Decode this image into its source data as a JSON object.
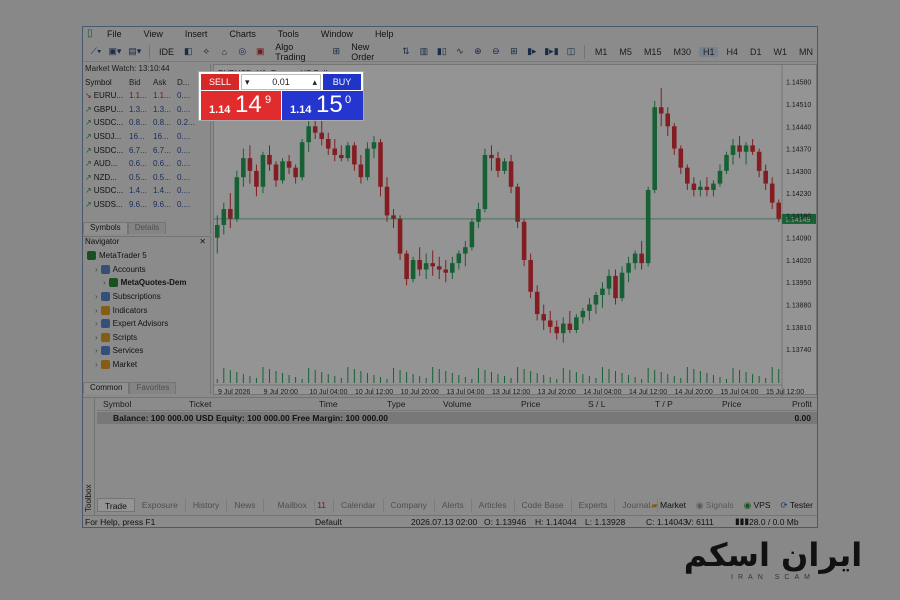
{
  "menu": [
    "File",
    "View",
    "Insert",
    "Charts",
    "Tools",
    "Window",
    "Help"
  ],
  "toolbar": {
    "ide_label": "IDE",
    "algo_trading": "Algo Trading",
    "new_order": "New Order",
    "timeframes": [
      "M1",
      "M5",
      "M15",
      "M30",
      "H1",
      "H4",
      "D1",
      "W1",
      "MN"
    ],
    "active_timeframe": "H1"
  },
  "market_watch": {
    "title": "Market Watch: 13:10:44",
    "headers": [
      "Symbol",
      "Bid",
      "Ask",
      "D..."
    ],
    "rows": [
      {
        "symbol": "EURU...",
        "bid": "1.1...",
        "ask": "1.1...",
        "d": "0....",
        "dir": "down"
      },
      {
        "symbol": "GBPU...",
        "bid": "1.3...",
        "ask": "1.3...",
        "d": "0....",
        "dir": "up"
      },
      {
        "symbol": "USDC...",
        "bid": "0.8...",
        "ask": "0.8...",
        "d": "0.2...",
        "dir": "up"
      },
      {
        "symbol": "USDJ...",
        "bid": "16...",
        "ask": "16...",
        "d": "0....",
        "dir": "up"
      },
      {
        "symbol": "USDC...",
        "bid": "6.7...",
        "ask": "6.7...",
        "d": "0....",
        "dir": "up"
      },
      {
        "symbol": "AUD...",
        "bid": "0.6...",
        "ask": "0.6...",
        "d": "0....",
        "dir": "up"
      },
      {
        "symbol": "NZD...",
        "bid": "0.5...",
        "ask": "0.5...",
        "d": "0....",
        "dir": "up"
      },
      {
        "symbol": "USDC...",
        "bid": "1.4...",
        "ask": "1.4...",
        "d": "0....",
        "dir": "up"
      },
      {
        "symbol": "USDS...",
        "bid": "9.6...",
        "ask": "9.6...",
        "d": "0....",
        "dir": "up"
      }
    ],
    "tabs": [
      "Symbols",
      "Details"
    ]
  },
  "navigator": {
    "title": "Navigator",
    "items": [
      {
        "label": "MetaTrader 5",
        "indent": 0,
        "color": "#2a8a3a"
      },
      {
        "label": "Accounts",
        "indent": 1,
        "color": "#5a8ad0"
      },
      {
        "label": "MetaQuotes-Dem",
        "indent": 2,
        "color": "#2a8a3a"
      },
      {
        "label": "Subscriptions",
        "indent": 1,
        "color": "#5a8ad0"
      },
      {
        "label": "Indicators",
        "indent": 1,
        "color": "#e0a020"
      },
      {
        "label": "Expert Advisors",
        "indent": 1,
        "color": "#5a8ad0"
      },
      {
        "label": "Scripts",
        "indent": 1,
        "color": "#e0a020"
      },
      {
        "label": "Services",
        "indent": 1,
        "color": "#5a8ad0"
      },
      {
        "label": "Market",
        "indent": 1,
        "color": "#e0a020"
      }
    ],
    "tabs": [
      "Common",
      "Favorites"
    ]
  },
  "trade_panel": {
    "sell_label": "SELL",
    "buy_label": "BUY",
    "lot": "0.01",
    "sell_prefix": "1.14",
    "sell_big": "14",
    "sell_sup": "9",
    "buy_prefix": "1.14",
    "buy_big": "15",
    "buy_sup": "0"
  },
  "chart": {
    "symbol_title": "EURUSD, H1: Euro vs US Dollar",
    "price_labels": [
      "1.14580",
      "1.14510",
      "1.14440",
      "1.14370",
      "1.14300",
      "1.14230",
      "1.14160",
      "1.14090",
      "1.14020",
      "1.13950",
      "1.13880",
      "1.13810",
      "1.13740"
    ],
    "time_labels": [
      "9 Jul 2026",
      "9 Jul 20:00",
      "10 Jul 04:00",
      "10 Jul 12:00",
      "10 Jul 20:00",
      "13 Jul 04:00",
      "13 Jul 12:00",
      "13 Jul 20:00",
      "14 Jul 04:00",
      "14 Jul 12:00",
      "14 Jul 20:00",
      "15 Jul 04:00",
      "15 Jul 12:00"
    ],
    "current_price_label": "1.14149",
    "up_color": "#26a65b",
    "down_color": "#e0333a"
  },
  "chart_data": {
    "type": "candlestick",
    "ohlc": [
      [
        1.1409,
        1.1416,
        1.1404,
        1.1413
      ],
      [
        1.1413,
        1.142,
        1.141,
        1.1418
      ],
      [
        1.1418,
        1.1423,
        1.1412,
        1.1415
      ],
      [
        1.1415,
        1.143,
        1.1414,
        1.1428
      ],
      [
        1.1428,
        1.1437,
        1.1425,
        1.1434
      ],
      [
        1.1434,
        1.1438,
        1.1426,
        1.143
      ],
      [
        1.143,
        1.1432,
        1.1422,
        1.1425
      ],
      [
        1.1425,
        1.1436,
        1.1423,
        1.1435
      ],
      [
        1.1435,
        1.1438,
        1.143,
        1.1432
      ],
      [
        1.1432,
        1.1433,
        1.1425,
        1.1427
      ],
      [
        1.1427,
        1.1434,
        1.1426,
        1.1433
      ],
      [
        1.1433,
        1.1435,
        1.1429,
        1.1431
      ],
      [
        1.1431,
        1.1432,
        1.1426,
        1.1428
      ],
      [
        1.1428,
        1.144,
        1.1427,
        1.1439
      ],
      [
        1.1439,
        1.1447,
        1.1436,
        1.1444
      ],
      [
        1.1444,
        1.145,
        1.144,
        1.1442
      ],
      [
        1.1442,
        1.1446,
        1.1438,
        1.144
      ],
      [
        1.144,
        1.1442,
        1.1435,
        1.1437
      ],
      [
        1.1437,
        1.144,
        1.1433,
        1.1435
      ],
      [
        1.1435,
        1.1438,
        1.1433,
        1.1434
      ],
      [
        1.1434,
        1.1439,
        1.1433,
        1.1438
      ],
      [
        1.1438,
        1.1439,
        1.143,
        1.1432
      ],
      [
        1.1432,
        1.1435,
        1.1426,
        1.1428
      ],
      [
        1.1428,
        1.1439,
        1.1427,
        1.1437
      ],
      [
        1.1437,
        1.1441,
        1.1434,
        1.1439
      ],
      [
        1.1439,
        1.144,
        1.1422,
        1.1425
      ],
      [
        1.1425,
        1.1428,
        1.1414,
        1.1416
      ],
      [
        1.1416,
        1.1418,
        1.1412,
        1.1415
      ],
      [
        1.1415,
        1.1416,
        1.1402,
        1.1404
      ],
      [
        1.1404,
        1.1405,
        1.1394,
        1.1396
      ],
      [
        1.1396,
        1.1403,
        1.1395,
        1.1402
      ],
      [
        1.1402,
        1.1406,
        1.1397,
        1.1399
      ],
      [
        1.1399,
        1.1404,
        1.1396,
        1.1401
      ],
      [
        1.1401,
        1.1405,
        1.1397,
        1.14
      ],
      [
        1.14,
        1.1403,
        1.1396,
        1.1399
      ],
      [
        1.1399,
        1.1402,
        1.1395,
        1.1398
      ],
      [
        1.1398,
        1.1403,
        1.1396,
        1.1401
      ],
      [
        1.1401,
        1.1405,
        1.1399,
        1.1404
      ],
      [
        1.1404,
        1.1408,
        1.14,
        1.1406
      ],
      [
        1.1406,
        1.1415,
        1.1405,
        1.1414
      ],
      [
        1.1414,
        1.142,
        1.1412,
        1.1418
      ],
      [
        1.1418,
        1.1437,
        1.1417,
        1.1435
      ],
      [
        1.1435,
        1.1438,
        1.143,
        1.1434
      ],
      [
        1.1434,
        1.1436,
        1.1428,
        1.143
      ],
      [
        1.143,
        1.1434,
        1.1429,
        1.1433
      ],
      [
        1.1433,
        1.1435,
        1.1423,
        1.1425
      ],
      [
        1.1425,
        1.1426,
        1.1412,
        1.1414
      ],
      [
        1.1414,
        1.1415,
        1.14,
        1.1402
      ],
      [
        1.1402,
        1.1404,
        1.139,
        1.1392
      ],
      [
        1.1392,
        1.1394,
        1.1383,
        1.1385
      ],
      [
        1.1385,
        1.1388,
        1.138,
        1.1383
      ],
      [
        1.1383,
        1.1386,
        1.1379,
        1.1381
      ],
      [
        1.1381,
        1.1383,
        1.1377,
        1.1379
      ],
      [
        1.1379,
        1.1384,
        1.1376,
        1.1382
      ],
      [
        1.1382,
        1.1386,
        1.1379,
        1.138
      ],
      [
        1.138,
        1.1385,
        1.1379,
        1.1384
      ],
      [
        1.1384,
        1.1387,
        1.1382,
        1.1386
      ],
      [
        1.1386,
        1.139,
        1.1383,
        1.1388
      ],
      [
        1.1388,
        1.1392,
        1.1385,
        1.1391
      ],
      [
        1.1391,
        1.1395,
        1.1387,
        1.1393
      ],
      [
        1.1393,
        1.1399,
        1.1391,
        1.1397
      ],
      [
        1.1397,
        1.1399,
        1.1388,
        1.139
      ],
      [
        1.139,
        1.14,
        1.1389,
        1.1398
      ],
      [
        1.1398,
        1.1403,
        1.1395,
        1.1401
      ],
      [
        1.1401,
        1.1405,
        1.1399,
        1.1404
      ],
      [
        1.1404,
        1.1408,
        1.1399,
        1.1401
      ],
      [
        1.1401,
        1.1425,
        1.14,
        1.1424
      ],
      [
        1.1424,
        1.1452,
        1.1423,
        1.145
      ],
      [
        1.145,
        1.1456,
        1.1444,
        1.1448
      ],
      [
        1.1448,
        1.145,
        1.1441,
        1.1444
      ],
      [
        1.1444,
        1.1445,
        1.1435,
        1.1437
      ],
      [
        1.1437,
        1.1438,
        1.1429,
        1.1431
      ],
      [
        1.1431,
        1.1432,
        1.1424,
        1.1426
      ],
      [
        1.1426,
        1.1428,
        1.1422,
        1.1424
      ],
      [
        1.1424,
        1.1427,
        1.1422,
        1.1425
      ],
      [
        1.1425,
        1.1428,
        1.1422,
        1.1424
      ],
      [
        1.1424,
        1.1427,
        1.1422,
        1.1426
      ],
      [
        1.1426,
        1.1432,
        1.1425,
        1.143
      ],
      [
        1.143,
        1.1436,
        1.1429,
        1.1435
      ],
      [
        1.1435,
        1.144,
        1.1432,
        1.1438
      ],
      [
        1.1438,
        1.1441,
        1.1434,
        1.1436
      ],
      [
        1.1436,
        1.1439,
        1.1432,
        1.1438
      ],
      [
        1.1438,
        1.144,
        1.1435,
        1.1436
      ],
      [
        1.1436,
        1.1437,
        1.1428,
        1.143
      ],
      [
        1.143,
        1.1432,
        1.1424,
        1.1426
      ],
      [
        1.1426,
        1.1428,
        1.1418,
        1.142
      ],
      [
        1.142,
        1.1421,
        1.1414,
        1.1415
      ]
    ],
    "ylim": [
      1.1369,
      1.1462
    ],
    "current_price": 1.14149,
    "x_tick_labels": [
      "9 Jul 2026",
      "9 Jul 20:00",
      "10 Jul 04:00",
      "10 Jul 12:00",
      "10 Jul 20:00",
      "13 Jul 04:00",
      "13 Jul 12:00",
      "13 Jul 20:00",
      "14 Jul 04:00",
      "14 Jul 12:00",
      "14 Jul 20:00",
      "15 Jul 04:00",
      "15 Jul 12:00"
    ],
    "y_tick_labels": [
      "1.14580",
      "1.14510",
      "1.14440",
      "1.14370",
      "1.14300",
      "1.14230",
      "1.14160",
      "1.14090",
      "1.14020",
      "1.13950",
      "1.13880",
      "1.13810",
      "1.13740"
    ],
    "grid": false
  },
  "toolbox": {
    "side_label": "Toolbox",
    "headers": [
      "Symbol",
      "Ticket",
      "Time",
      "Type",
      "Volume",
      "Price",
      "S / L",
      "T / P",
      "Price",
      "Profit"
    ],
    "balance_line": "Balance: 100 000.00 USD  Equity: 100 000.00  Free Margin: 100 000.00",
    "balance_value": "0.00",
    "tabs": [
      "Trade",
      "Exposure",
      "History",
      "News",
      "Mailbox",
      "Calendar",
      "Company",
      "Alerts",
      "Articles",
      "Code Base",
      "Experts",
      "Journal"
    ],
    "mailbox_count": "11",
    "right_items": [
      "Market",
      "Signals",
      "VPS",
      "Tester"
    ]
  },
  "status": {
    "help": "For Help, press F1",
    "profile": "Default",
    "datetime": "2026.07.13 02:00",
    "open": "O: 1.13946",
    "high": "H: 1.14044",
    "low": "L: 1.13928",
    "close": "C: 1.14043",
    "volume": "V: 6111",
    "traffic": "28.0 / 0.0 Mb"
  },
  "watermark": {
    "brand": "ایران اسکم",
    "sub": "IRAN SCAM"
  }
}
